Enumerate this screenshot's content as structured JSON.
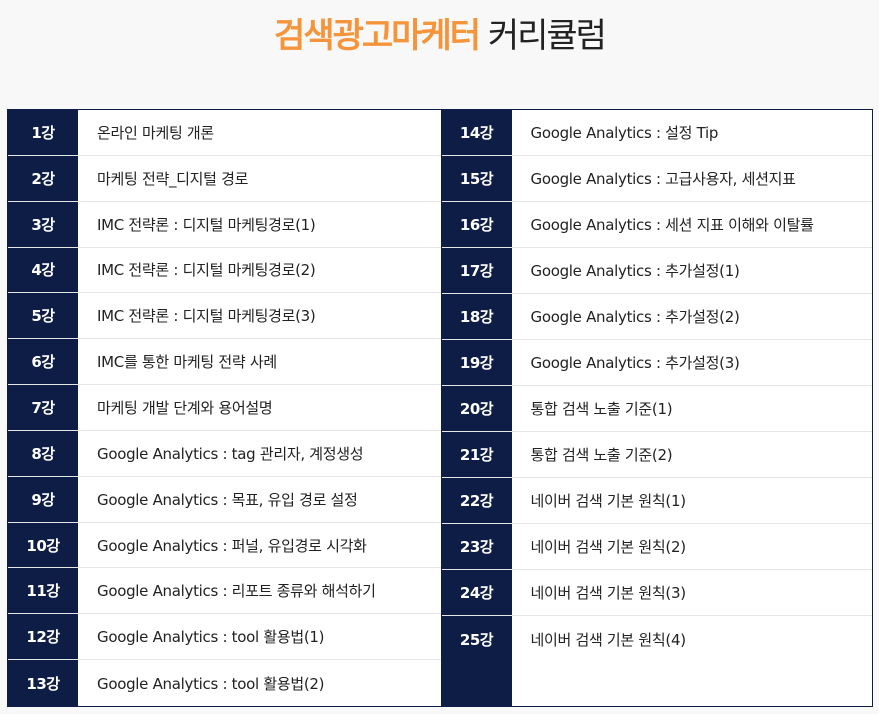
{
  "header": {
    "title_accent": "검색광고마케터",
    "title_rest": "커리큘럼"
  },
  "left_lessons": [
    {
      "num": "1강",
      "title": "온라인 마케팅 개론"
    },
    {
      "num": "2강",
      "title": "마케팅 전략_디지털 경로"
    },
    {
      "num": "3강",
      "title": "IMC 전략론 : 디지털 마케팅경로(1)"
    },
    {
      "num": "4강",
      "title": "IMC 전략론 : 디지털 마케팅경로(2)"
    },
    {
      "num": "5강",
      "title": "IMC 전략론 : 디지털 마케팅경로(3)"
    },
    {
      "num": "6강",
      "title": "IMC를 통한 마케팅 전략 사례"
    },
    {
      "num": "7강",
      "title": "마케팅 개발 단계와 용어설명"
    },
    {
      "num": "8강",
      "title": "Google Analytics : tag 관리자, 계정생성"
    },
    {
      "num": "9강",
      "title": "Google Analytics : 목표, 유입 경로 설정"
    },
    {
      "num": "10강",
      "title": "Google Analytics : 퍼널, 유입경로 시각화"
    },
    {
      "num": "11강",
      "title": "Google Analytics : 리포트 종류와 해석하기"
    },
    {
      "num": "12강",
      "title": "Google Analytics : tool 활용법(1)"
    },
    {
      "num": "13강",
      "title": "Google Analytics : tool 활용법(2)"
    }
  ],
  "right_lessons": [
    {
      "num": "14강",
      "title": "Google Analytics : 설정 Tip"
    },
    {
      "num": "15강",
      "title": "Google Analytics : 고급사용자, 세션지표"
    },
    {
      "num": "16강",
      "title": "Google Analytics : 세션 지표 이해와 이탈률"
    },
    {
      "num": "17강",
      "title": "Google Analytics : 추가설정(1)"
    },
    {
      "num": "18강",
      "title": "Google Analytics : 추가설정(2)"
    },
    {
      "num": "19강",
      "title": "Google Analytics : 추가설정(3)"
    },
    {
      "num": "20강",
      "title": "통합 검색 노출 기준(1)"
    },
    {
      "num": "21강",
      "title": "통합 검색 노출 기준(2)"
    },
    {
      "num": "22강",
      "title": "네이버 검색 기본 원칙(1)"
    },
    {
      "num": "23강",
      "title": "네이버 검색 기본 원칙(2)"
    },
    {
      "num": "24강",
      "title": "네이버 검색 기본 원칙(3)"
    },
    {
      "num": "25강",
      "title": "네이버 검색 기본 원칙(4)"
    }
  ],
  "colors": {
    "accent": "#f5943a",
    "navy": "#0e1d45"
  }
}
